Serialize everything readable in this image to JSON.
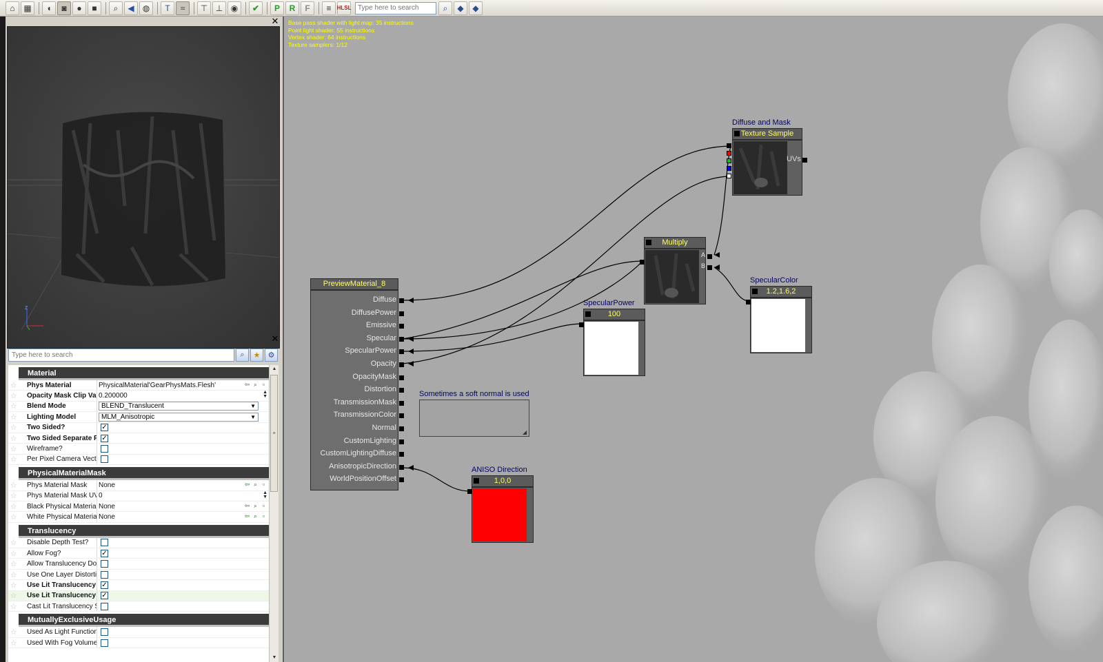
{
  "toolbar": {
    "buttons": [
      {
        "name": "home-icon",
        "glyph": "⌂"
      },
      {
        "name": "grid-icon",
        "glyph": "▦"
      },
      {
        "name": "cylinder-icon",
        "glyph": "◖"
      },
      {
        "name": "cube-icon",
        "glyph": "◙"
      },
      {
        "name": "sphere-icon",
        "glyph": "●"
      },
      {
        "name": "plane-icon",
        "glyph": "■"
      },
      {
        "name": "zoom-icon",
        "glyph": "⌕"
      },
      {
        "name": "back-arrow-icon",
        "glyph": "◀"
      },
      {
        "name": "globe-icon",
        "glyph": "◍"
      },
      {
        "name": "text-tool-icon",
        "glyph": "T"
      },
      {
        "name": "curve-icon",
        "glyph": "≈"
      },
      {
        "name": "align-top-icon",
        "glyph": "⊤"
      },
      {
        "name": "align-bottom-icon",
        "glyph": "⊥"
      },
      {
        "name": "eye-icon",
        "glyph": "◉"
      },
      {
        "name": "check-icon",
        "glyph": "✔"
      },
      {
        "name": "p-icon",
        "glyph": "P"
      },
      {
        "name": "r-icon",
        "glyph": "R"
      },
      {
        "name": "f-icon",
        "glyph": "F"
      },
      {
        "name": "list-icon",
        "glyph": "≡"
      },
      {
        "name": "hlsl-icon",
        "glyph": "HLSL"
      }
    ],
    "search_placeholder": "Type here to search",
    "search_buttons": [
      "⌕",
      "◆",
      "◆"
    ]
  },
  "preview": {
    "close_glyph": "✕",
    "axis_label": "z"
  },
  "properties": {
    "close_glyph": "✕",
    "search_placeholder": "Type here to search",
    "categories": [
      {
        "title": "Material",
        "rows": [
          {
            "name": "Phys Material",
            "bold": true,
            "type": "text",
            "value": "PhysicalMaterial'GearPhysMats.Flesh'",
            "icons": true
          },
          {
            "name": "Opacity Mask Clip Value",
            "bold": true,
            "type": "text",
            "value": "0.200000",
            "spin": true
          },
          {
            "name": "Blend Mode",
            "bold": true,
            "type": "combo",
            "value": "BLEND_Translucent"
          },
          {
            "name": "Lighting Model",
            "bold": true,
            "type": "combo",
            "value": "MLM_Anisotropic"
          },
          {
            "name": "Two Sided?",
            "bold": true,
            "type": "check",
            "checked": true
          },
          {
            "name": "Two Sided Separate Pas",
            "bold": true,
            "type": "check",
            "checked": true
          },
          {
            "name": "Wireframe?",
            "bold": false,
            "type": "check",
            "checked": false
          },
          {
            "name": "Per Pixel Camera Vector?",
            "bold": false,
            "type": "check",
            "checked": false
          }
        ]
      },
      {
        "title": "PhysicalMaterialMask",
        "rows": [
          {
            "name": "Phys Material Mask",
            "bold": false,
            "type": "text",
            "value": "None",
            "icons": true
          },
          {
            "name": "Phys Material Mask UVChann",
            "bold": false,
            "type": "text",
            "value": "0",
            "spin": true
          },
          {
            "name": "Black Physical Material",
            "bold": false,
            "type": "text",
            "value": "None",
            "icons": true
          },
          {
            "name": "White Physical Material",
            "bold": false,
            "type": "text",
            "value": "None",
            "icons": true
          }
        ]
      },
      {
        "title": "Translucency",
        "rows": [
          {
            "name": "Disable Depth Test?",
            "bold": false,
            "type": "check",
            "checked": false
          },
          {
            "name": "Allow Fog?",
            "bold": false,
            "type": "check",
            "checked": true
          },
          {
            "name": "Allow Translucency Do F?",
            "bold": false,
            "type": "check",
            "checked": false
          },
          {
            "name": "Use One Layer Distortion?",
            "bold": false,
            "type": "check",
            "checked": false
          },
          {
            "name": "Use Lit Translucency De",
            "bold": true,
            "type": "check",
            "checked": true
          },
          {
            "name": "Use Lit Translucency Pos",
            "bold": true,
            "type": "check",
            "checked": true,
            "highlight": true
          },
          {
            "name": "Cast Lit Translucency Shado",
            "bold": false,
            "type": "check",
            "checked": false
          }
        ]
      },
      {
        "title": "MutuallyExclusiveUsage",
        "rows": [
          {
            "name": "Used As Light Function?",
            "bold": false,
            "type": "check",
            "checked": false
          },
          {
            "name": "Used With Fog Volumes?",
            "bold": false,
            "type": "check",
            "checked": false
          }
        ]
      }
    ]
  },
  "stats": [
    "Base pass shader with light map: 35 instructions",
    "Point light shader: 55 instructions",
    "Vertex shader: 64 instructions",
    "Texture samplers: 1/12"
  ],
  "nodes": {
    "preview_material": {
      "title": "PreviewMaterial_8",
      "inputs": [
        "Diffuse",
        "DiffusePower",
        "Emissive",
        "Specular",
        "SpecularPower",
        "Opacity",
        "OpacityMask",
        "Distortion",
        "TransmissionMask",
        "TransmissionColor",
        "Normal",
        "CustomLighting",
        "CustomLightingDiffuse",
        "AnisotropicDirection",
        "WorldPositionOffset"
      ]
    },
    "texture_sample": {
      "caption": "Diffuse and Mask",
      "title": "Texture Sample",
      "pin_label": "UVs",
      "channel_colors": [
        "#000000",
        "#ff0000",
        "#00cc00",
        "#0000ff",
        "#ffffff"
      ]
    },
    "multiply": {
      "title": "Multiply",
      "pin_a": "A",
      "pin_b": "B"
    },
    "specular_power": {
      "caption": "SpecularPower",
      "title": "100",
      "swatch": "#ffffff"
    },
    "specular_color": {
      "caption": "SpecularColor",
      "title": "1.2,1.6,2",
      "swatch": "#ffffff"
    },
    "aniso_direction": {
      "caption": "ANISO Direction",
      "title": "1,0,0",
      "swatch": "#ff0000"
    }
  },
  "comment": {
    "text": "Sometimes a soft normal is used"
  }
}
